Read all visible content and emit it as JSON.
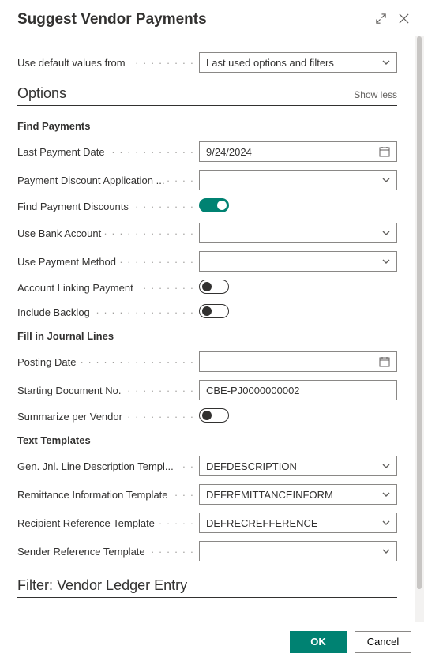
{
  "header": {
    "title": "Suggest Vendor Payments"
  },
  "defaults": {
    "label": "Use default values from",
    "value": "Last used options and filters"
  },
  "options": {
    "title": "Options",
    "toggle_label": "Show less"
  },
  "find_payments": {
    "heading": "Find Payments",
    "last_payment_date": {
      "label": "Last Payment Date",
      "value": "9/24/2024"
    },
    "discount_app": {
      "label": "Payment Discount Application ...",
      "value": ""
    },
    "find_discounts": {
      "label": "Find Payment Discounts",
      "on": true
    },
    "use_bank": {
      "label": "Use Bank Account",
      "value": ""
    },
    "use_method": {
      "label": "Use Payment Method",
      "value": ""
    },
    "acct_linking": {
      "label": "Account Linking Payment",
      "on": false
    },
    "include_backlog": {
      "label": "Include Backlog",
      "on": false
    }
  },
  "journal": {
    "heading": "Fill in Journal Lines",
    "posting_date": {
      "label": "Posting Date",
      "value": ""
    },
    "start_doc": {
      "label": "Starting Document No.",
      "value": "CBE-PJ0000000002"
    },
    "summarize": {
      "label": "Summarize per Vendor",
      "on": false
    }
  },
  "templates": {
    "heading": "Text Templates",
    "gen_desc": {
      "label": "Gen. Jnl. Line Description Templ...",
      "value": "DEFDESCRIPTION"
    },
    "remittance": {
      "label": "Remittance Information Template",
      "value": "DEFREMITTANCEINFORM"
    },
    "recipient": {
      "label": "Recipient Reference Template",
      "value": "DEFRECREFFERENCE"
    },
    "sender": {
      "label": "Sender Reference Template",
      "value": ""
    }
  },
  "filter": {
    "title": "Filter: Vendor Ledger Entry"
  },
  "footer": {
    "ok": "OK",
    "cancel": "Cancel"
  }
}
